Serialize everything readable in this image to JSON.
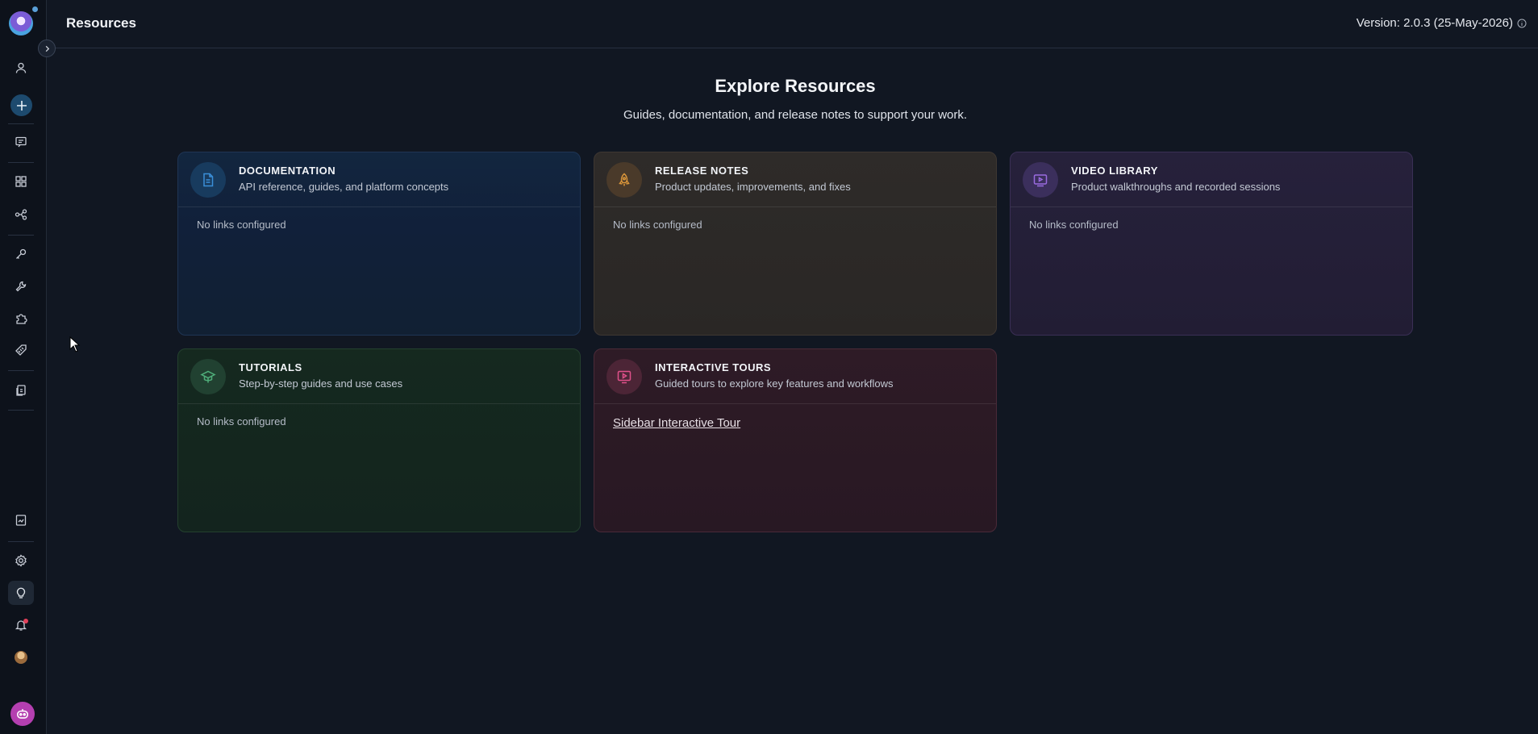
{
  "header": {
    "title": "Resources",
    "version": "Version: 2.0.3 (25-May-2026)"
  },
  "hero": {
    "title": "Explore Resources",
    "subtitle": "Guides, documentation, and release notes to support your work."
  },
  "sidebar": {
    "icons": [
      "user-icon",
      "plus-icon",
      "chat-icon",
      "grid-icon",
      "workflow-icon",
      "key-icon",
      "wrench-icon",
      "puzzle-icon",
      "tag-icon",
      "copy-icon",
      "report-icon",
      "settings-icon",
      "lightbulb-icon",
      "bell-icon",
      "avatar",
      "bot-icon"
    ],
    "accent": "#1d4a6e"
  },
  "cards": [
    {
      "id": "documentation",
      "title": "DOCUMENTATION",
      "description": "API reference, guides, and platform concepts",
      "empty_text": "No links configured",
      "icon": "document-icon",
      "color": "#3a8fd8"
    },
    {
      "id": "release-notes",
      "title": "RELEASE NOTES",
      "description": "Product updates, improvements, and fixes",
      "empty_text": "No links configured",
      "icon": "rocket-icon",
      "color": "#d9953a"
    },
    {
      "id": "video-library",
      "title": "VIDEO LIBRARY",
      "description": "Product walkthroughs and recorded sessions",
      "empty_text": "No links configured",
      "icon": "video-icon",
      "color": "#9a6be0"
    },
    {
      "id": "tutorials",
      "title": "TUTORIALS",
      "description": "Step-by-step guides and use cases",
      "empty_text": "No links configured",
      "icon": "graduation-cap-icon",
      "color": "#4fae7a"
    },
    {
      "id": "interactive-tours",
      "title": "INTERACTIVE TOURS",
      "description": "Guided tours to explore key features and workflows",
      "link": "Sidebar Interactive Tour",
      "icon": "play-screen-icon",
      "color": "#e0508a"
    }
  ]
}
